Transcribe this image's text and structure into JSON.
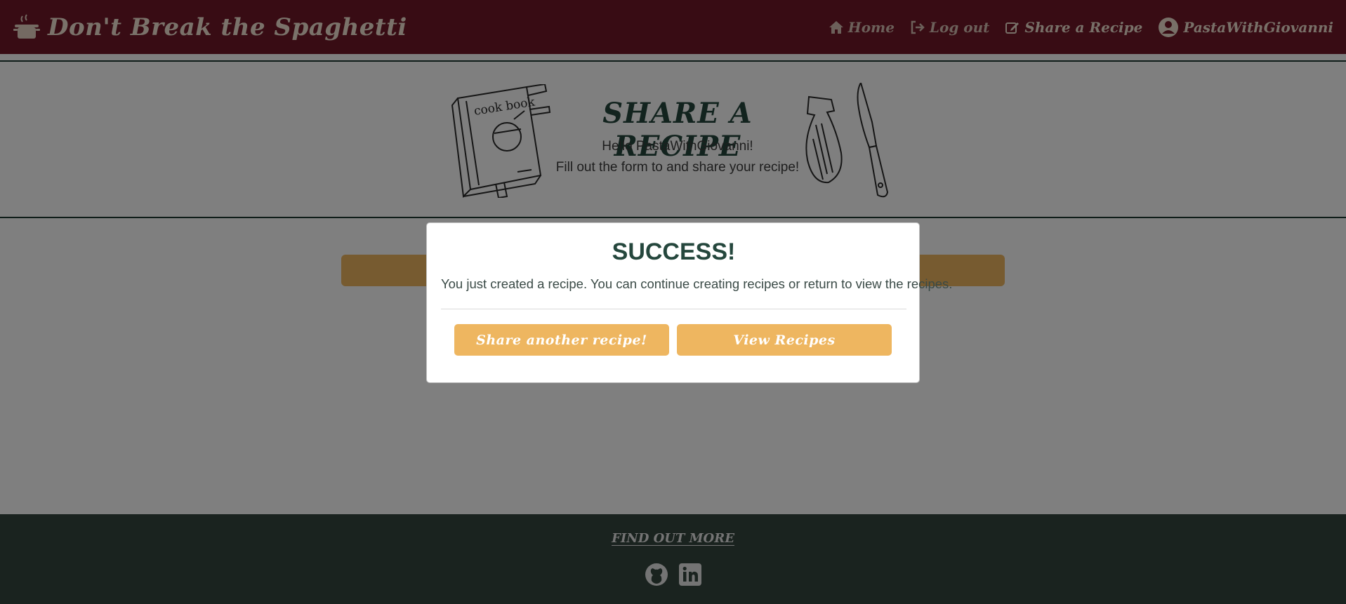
{
  "navbar": {
    "brand_icon": "cooking-pot-icon",
    "brand_name": "Don't Break the Spaghetti",
    "links": [
      {
        "label": "Home",
        "icon": "home-icon"
      },
      {
        "label": "Log out",
        "icon": "log-out-icon"
      },
      {
        "label": "Share a Recipe",
        "icon": "edit-icon"
      },
      {
        "label": "PastaWithGiovanni",
        "icon": "user-circle-icon"
      }
    ]
  },
  "header": {
    "title": "SHARE A RECIPE",
    "greeting": "Hello PastaWithGiovanni!",
    "subtitle": "Fill out the form to and share your recipe!",
    "cookbook_label": "cook book",
    "left_image": "cookbook-illustration",
    "right_image": "cutting-board-knife-illustration"
  },
  "modal": {
    "title": "SUCCESS!",
    "message": "You just created a recipe. You can continue creating recipes or return to view the recipes.",
    "share_button": "Share another recipe!",
    "view_button": "View Recipes"
  },
  "footer": {
    "title": "FIND OUT MORE",
    "social": [
      {
        "icon": "github-icon"
      },
      {
        "icon": "linkedin-icon"
      }
    ]
  },
  "colors": {
    "navbar_bg": "#701928",
    "accent_gold": "#eeb660",
    "heading_green": "#25473d",
    "footer_bg": "#35463f",
    "overlay": "rgba(0,0,0,0.5)"
  }
}
